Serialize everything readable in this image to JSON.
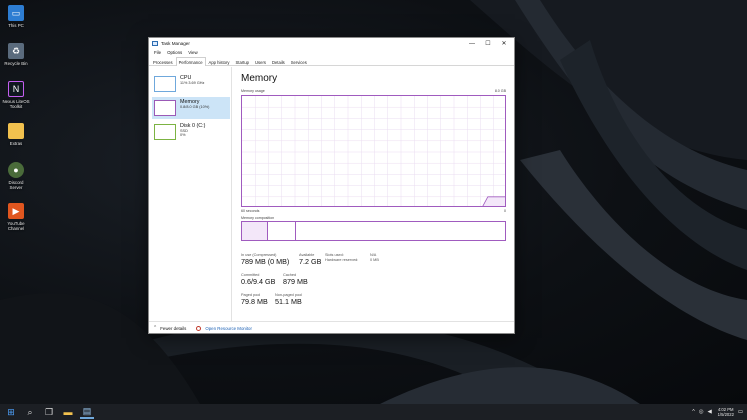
{
  "desktop": {
    "icons": [
      {
        "label": "This PC",
        "icon": "monitor-icon"
      },
      {
        "label": "Recycle Bin",
        "icon": "recycle-bin-icon"
      },
      {
        "label": "Nexus LiteOS Toolkit",
        "icon": "toolkit-icon"
      },
      {
        "label": "Extras",
        "icon": "folder-icon"
      },
      {
        "label": "Discord Server",
        "icon": "discord-icon"
      },
      {
        "label": "YouTube Channel",
        "icon": "youtube-icon"
      }
    ]
  },
  "window": {
    "title": "Task Manager",
    "controls": {
      "minimize": "—",
      "maximize": "☐",
      "close": "✕"
    },
    "menu": [
      "File",
      "Options",
      "View"
    ],
    "tabs": [
      "Processes",
      "Performance",
      "App history",
      "Startup",
      "Users",
      "Details",
      "Services"
    ],
    "active_tab": "Performance"
  },
  "sidebar": {
    "items": [
      {
        "name": "CPU",
        "sub1": "11% 3.69 GHz",
        "sub2": ""
      },
      {
        "name": "Memory",
        "sub1": "0.8/8.0 GB (10%)",
        "sub2": ""
      },
      {
        "name": "Disk 0 (C:)",
        "sub1": "SSD",
        "sub2": "0%"
      }
    ]
  },
  "panel": {
    "heading": "Memory",
    "usage_label": "Memory usage",
    "usage_max": "8.0 GB",
    "time_label": "60 seconds",
    "time_end": "0",
    "composition_label": "Memory composition",
    "usage_fraction": 0.1,
    "stats": {
      "in_use_label": "In use (Compressed)",
      "in_use_value": "789 MB (0 MB)",
      "available_label": "Available",
      "available_value": "7.2 GB",
      "committed_label": "Committed",
      "committed_value": "0.6/9.4 GB",
      "cached_label": "Cached",
      "cached_value": "879 MB",
      "paged_label": "Paged pool",
      "paged_value": "79.8 MB",
      "nonpaged_label": "Non-paged pool",
      "nonpaged_value": "51.1 MB",
      "slots_label": "Slots used:",
      "slots_value": "N/A",
      "hw_reserved_label": "Hardware reserved:",
      "hw_reserved_value": "0 MB"
    }
  },
  "footer": {
    "fewer_details": "Fewer details",
    "open_monitor": "Open Resource Monitor"
  },
  "taskbar": {
    "apps": [
      "windows-start-icon",
      "search-icon",
      "task-view-icon",
      "file-explorer-icon",
      "task-manager-icon"
    ],
    "tray": {
      "chevron": "^",
      "time": "4:02 PM",
      "date": "1/5/2022"
    }
  },
  "colors": {
    "memory_accent": "#a05bbf",
    "cpu_accent": "#6fa8dc",
    "disk_accent": "#7cb342",
    "selected_bg": "#cce4f7",
    "link": "#1a5fb4"
  }
}
